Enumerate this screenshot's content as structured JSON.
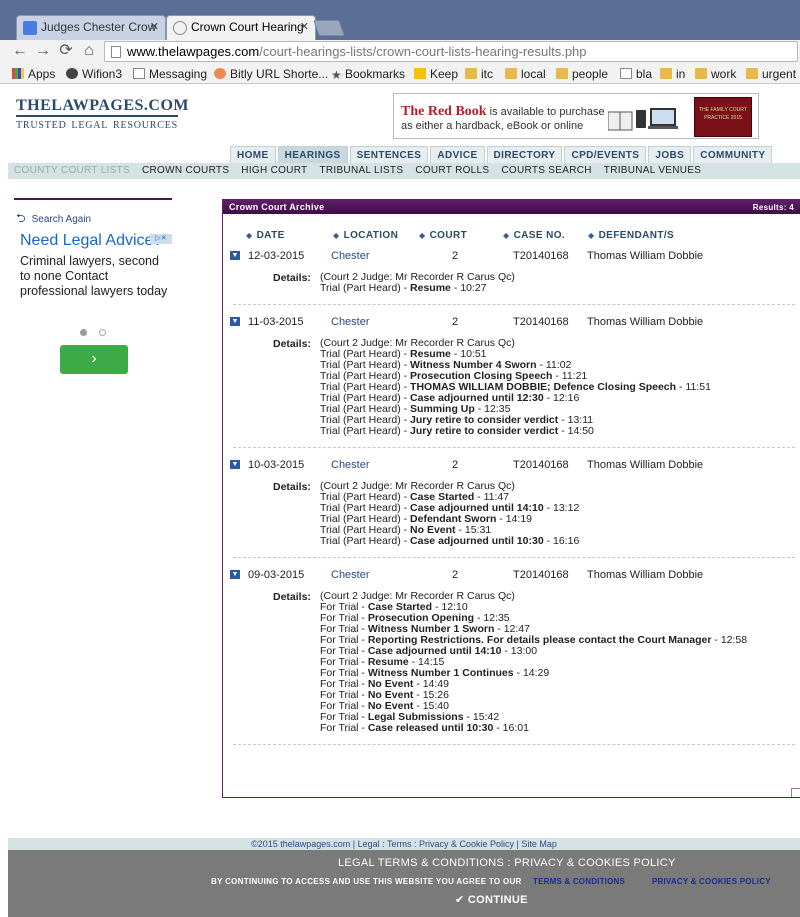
{
  "browser": {
    "tabs": [
      {
        "label": "Judges Chester Crow",
        "active": false
      },
      {
        "label": "Crown Court Hearing",
        "active": true
      }
    ],
    "url_domain": "www.thelawpages.com",
    "url_path": "/court-hearings-lists/crown-court-lists-hearing-results.php",
    "bookmarks": [
      "Apps",
      "Wifion3",
      "Messaging",
      "Bitly URL Shorte...",
      "Bookmarks",
      "Keep",
      "itc",
      "local",
      "people",
      "bla",
      "in",
      "work",
      "urgent"
    ]
  },
  "site": {
    "logo": "THELAWPAGES.COM",
    "tagline": [
      "TRUSTED",
      "LEGAL",
      "RESOURCES"
    ]
  },
  "top_ad": {
    "title": "The Red Book",
    "line1": " is available to purchase",
    "line2": "as either a hardback, eBook or online",
    "book_text": "THE FAMILY COURT PRACTICE 2015"
  },
  "main_nav": [
    "HOME",
    "HEARINGS",
    "SENTENCES",
    "ADVICE",
    "DIRECTORY",
    "CPD/EVENTS",
    "JOBS",
    "COMMUNITY"
  ],
  "sub_nav": [
    "COUNTY COURT LISTS",
    "CROWN COURTS",
    "HIGH COURT",
    "TRIBUNAL LISTS",
    "COURT ROLLS",
    "COURTS SEARCH",
    "TRIBUNAL VENUES"
  ],
  "sidebar": {
    "search_again": "Search Again",
    "ad_head": "Need Legal Advice?",
    "ad_body": "Criminal lawyers, second to none Contact professional lawyers today",
    "ad_button": "›"
  },
  "archive": {
    "title": "Crown Court Archive",
    "results": "Results: 4",
    "columns": [
      "DATE",
      "LOCATION",
      "COURT",
      "CASE NO.",
      "DEFENDANT/S"
    ],
    "details_label": "Details:",
    "cases": [
      {
        "date": "12-03-2015",
        "location": "Chester",
        "court": "2",
        "case_no": "T20140168",
        "defendant": "Thomas William Dobbie",
        "lines": [
          {
            "pre": "(Court 2 Judge: Mr Recorder R Carus Qc)",
            "bold": "",
            "post": ""
          },
          {
            "pre": "Trial (Part Heard) - ",
            "bold": "Resume",
            "post": " - 10:27"
          }
        ]
      },
      {
        "date": "11-03-2015",
        "location": "Chester",
        "court": "2",
        "case_no": "T20140168",
        "defendant": "Thomas William Dobbie",
        "lines": [
          {
            "pre": "(Court 2 Judge: Mr Recorder R Carus Qc)",
            "bold": "",
            "post": ""
          },
          {
            "pre": "Trial (Part Heard) - ",
            "bold": "Resume",
            "post": " - 10:51"
          },
          {
            "pre": "Trial (Part Heard) - ",
            "bold": "Witness Number 4 Sworn",
            "post": " - 11:02"
          },
          {
            "pre": "Trial (Part Heard) - ",
            "bold": "Prosecution Closing Speech",
            "post": " - 11:21"
          },
          {
            "pre": "Trial (Part Heard) - ",
            "bold": "THOMAS WILLIAM DOBBIE; Defence Closing Speech",
            "post": " - 11:51"
          },
          {
            "pre": "Trial (Part Heard) - ",
            "bold": "Case adjourned until 12:30",
            "post": " - 12:16"
          },
          {
            "pre": "Trial (Part Heard) - ",
            "bold": "Summing Up",
            "post": " - 12:35"
          },
          {
            "pre": "Trial (Part Heard) - ",
            "bold": "Jury retire to consider verdict",
            "post": " - 13:11"
          },
          {
            "pre": "Trial (Part Heard) - ",
            "bold": "Jury retire to consider verdict",
            "post": " - 14:50"
          }
        ]
      },
      {
        "date": "10-03-2015",
        "location": "Chester",
        "court": "2",
        "case_no": "T20140168",
        "defendant": "Thomas William Dobbie",
        "lines": [
          {
            "pre": "(Court 2 Judge: Mr Recorder R Carus Qc)",
            "bold": "",
            "post": ""
          },
          {
            "pre": "Trial (Part Heard) - ",
            "bold": "Case Started",
            "post": " - 11:47"
          },
          {
            "pre": "Trial (Part Heard) - ",
            "bold": "Case adjourned until 14:10",
            "post": " - 13:12"
          },
          {
            "pre": "Trial (Part Heard) - ",
            "bold": "Defendant Sworn",
            "post": " - 14:19"
          },
          {
            "pre": "Trial (Part Heard) - ",
            "bold": "No Event",
            "post": " - 15:31"
          },
          {
            "pre": "Trial (Part Heard) - ",
            "bold": "Case adjourned until 10:30",
            "post": " - 16:16"
          }
        ]
      },
      {
        "date": "09-03-2015",
        "location": "Chester",
        "court": "2",
        "case_no": "T20140168",
        "defendant": "Thomas William Dobbie",
        "lines": [
          {
            "pre": "(Court 2 Judge: Mr Recorder R Carus Qc)",
            "bold": "",
            "post": ""
          },
          {
            "pre": "For Trial - ",
            "bold": "Case Started",
            "post": " - 12:10"
          },
          {
            "pre": "For Trial - ",
            "bold": "Prosecution Opening",
            "post": " - 12:35"
          },
          {
            "pre": "For Trial - ",
            "bold": "Witness Number 1 Sworn",
            "post": " - 12:47"
          },
          {
            "pre": "For Trial - ",
            "bold": "Reporting Restrictions. For details please contact the Court Manager",
            "post": " - 12:58"
          },
          {
            "pre": "For Trial - ",
            "bold": "Case adjourned until 14:10",
            "post": " - 13:00"
          },
          {
            "pre": "For Trial - ",
            "bold": "Resume",
            "post": " - 14:15"
          },
          {
            "pre": "For Trial - ",
            "bold": "Witness Number 1 Continues",
            "post": " - 14:29"
          },
          {
            "pre": "For Trial - ",
            "bold": "No Event",
            "post": " - 14:49"
          },
          {
            "pre": "For Trial - ",
            "bold": "No Event",
            "post": " - 15:26"
          },
          {
            "pre": "For Trial - ",
            "bold": "No Event",
            "post": " - 15:40"
          },
          {
            "pre": "For Trial - ",
            "bold": "Legal Submissions",
            "post": " - 15:42"
          },
          {
            "pre": "For Trial - ",
            "bold": "Case released until 10:30",
            "post": " - 16:01"
          }
        ]
      }
    ]
  },
  "footer": {
    "copyright": "©2015 thelawpages.com | Legal : Terms : Privacy & Cookie Policy | Site Map"
  },
  "cookie_banner": {
    "title": "LEGAL TERMS & CONDITIONS : PRIVACY & COOKIES POLICY",
    "message": "BY CONTINUING TO ACCESS AND USE THIS WEBSITE YOU AGREE TO OUR",
    "terms_link": "TERMS & CONDITIONS",
    "privacy_link": "PRIVACY & COOKIES POLICY",
    "continue": "✔ CONTINUE"
  }
}
